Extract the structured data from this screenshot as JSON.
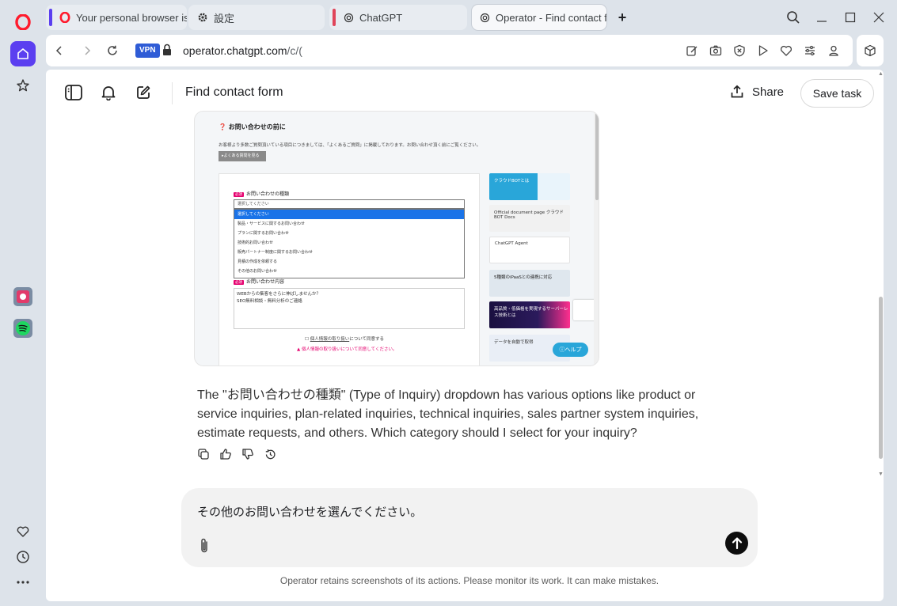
{
  "browser": {
    "tabs": [
      {
        "label": "Your personal browser is a",
        "stripe": "#5b3ff0",
        "icon": "opera-icon"
      },
      {
        "label": "設定",
        "stripe": "",
        "icon": "gear-icon"
      },
      {
        "label": "ChatGPT",
        "stripe": "#e0455a",
        "icon": "openai-icon"
      },
      {
        "label": "Operator - Find contact fo",
        "stripe": "",
        "icon": "openai-icon"
      }
    ],
    "vpn_label": "VPN",
    "url_domain": "operator.chatgpt.com",
    "url_path": "/c/("
  },
  "header": {
    "title": "Find contact form",
    "share_label": "Share",
    "save_label": "Save task"
  },
  "screenshot": {
    "heading": "お問い合わせの前に",
    "note": "お客様より多数ご質問頂いている項目につきましては、「よくあるご質問」に掲載しております。お問い合わせ頂く前にご覧ください。",
    "faq_button": "▸よくある質問を見る",
    "required_badge": "必須",
    "inquiry_type_label": "お問い合わせの種類",
    "select_placeholder": "選択してください",
    "options": [
      "選択してください",
      "製品・サービスに関するお問い合わせ",
      "プランに関するお問い合わせ",
      "技術的お問い合わせ",
      "販売パートナー制度に関するお問い合わせ",
      "見積の作成を依頼する",
      "その他のお問い合わせ"
    ],
    "content_label": "お問い合わせ内容",
    "textarea_lines": [
      "WEBからの集客をさらに伸ばしませんか？",
      "SEO無料相談・無料分析のご連絡"
    ],
    "privacy_pre": "個人情報の取り扱い",
    "privacy_post": "について同意する",
    "warning": "▲ 個人情報の取り扱いについて同意してください。",
    "banners": [
      "クラウドBOTとは",
      "Official document page クラウドBOT Docs",
      "ChatGPT Agent",
      "5種類のiPaaSとの連携に対応",
      "高品質・低価格を実現するサーバーレス技術とは",
      "データを自動で取得"
    ],
    "help_label": "ⓘヘルプ"
  },
  "message": {
    "text": "The \"お問い合わせの種類\" (Type of Inquiry) dropdown has various options like product or service inquiries, plan-related inquiries, technical inquiries, sales partner system inquiries, estimate requests, and others. Which category should I select for your inquiry?"
  },
  "composer": {
    "text": "その他のお問い合わせを選んでください。"
  },
  "disclaimer": "Operator retains screenshots of its actions. Please monitor its work. It can make mistakes."
}
